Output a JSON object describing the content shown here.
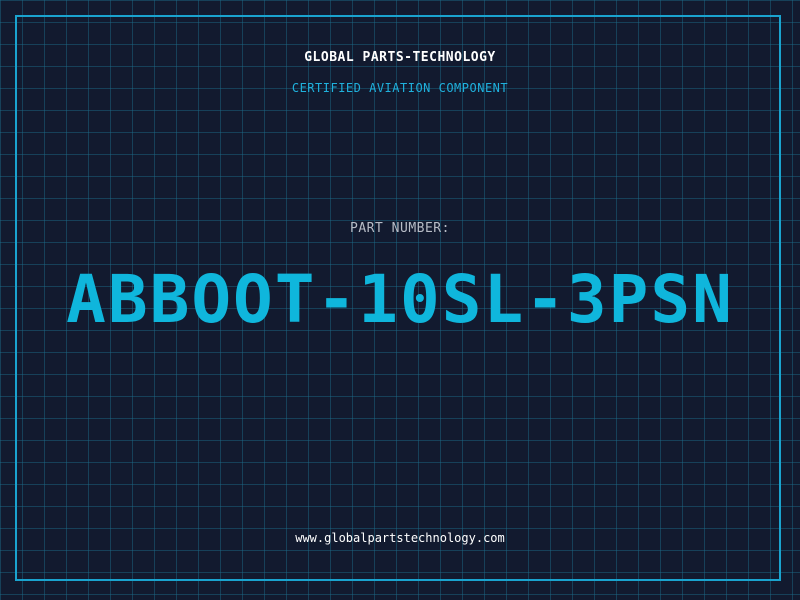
{
  "header": {
    "company": "GLOBAL PARTS-TECHNOLOGY",
    "subtitle": "CERTIFIED AVIATION COMPONENT"
  },
  "part": {
    "label": "PART NUMBER:",
    "number": "ABBOOT-10SL-3PSN"
  },
  "footer": {
    "website": "www.globalpartstechnology.com"
  },
  "colors": {
    "background": "#121a2f",
    "grid": "#1c6e8c",
    "accent": "#1aa3cf",
    "part_number": "#0fb6dc"
  }
}
